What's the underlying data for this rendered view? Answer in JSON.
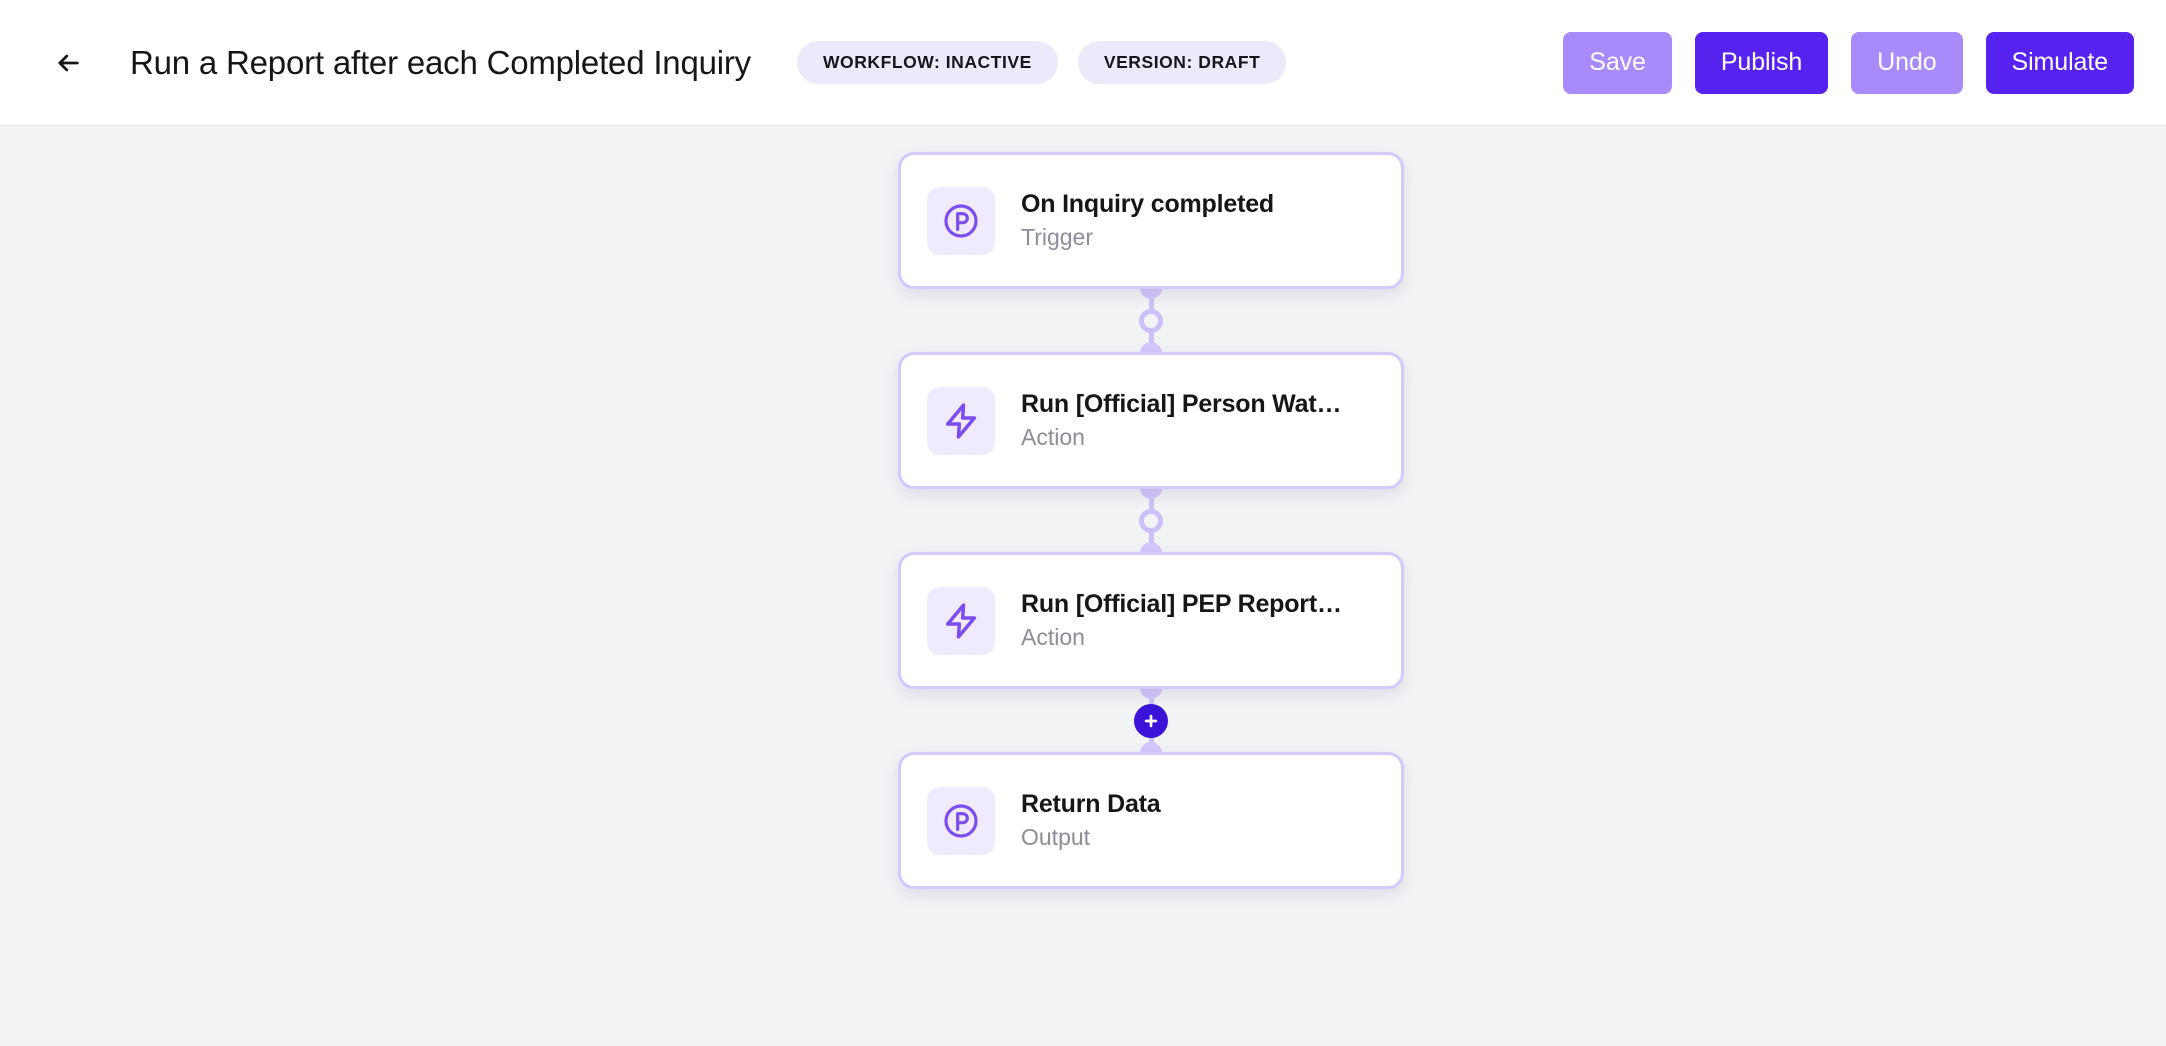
{
  "header": {
    "back_icon": "arrow-left-icon",
    "title": "Run a Report after each Completed Inquiry",
    "badges": [
      {
        "label": "WORKFLOW: INACTIVE"
      },
      {
        "label": "VERSION: DRAFT"
      }
    ],
    "buttons": [
      {
        "label": "Save",
        "style": "muted"
      },
      {
        "label": "Publish",
        "style": "strong"
      },
      {
        "label": "Undo",
        "style": "muted"
      },
      {
        "label": "Simulate",
        "style": "strong"
      }
    ]
  },
  "canvas": {
    "nodes": [
      {
        "icon": "circled-p-icon",
        "title": "On Inquiry completed",
        "subtitle": "Trigger"
      },
      {
        "icon": "zap-icon",
        "title": "Run [Official] Person Wat…",
        "subtitle": "Action"
      },
      {
        "icon": "zap-icon",
        "title": "Run [Official] PEP Report…",
        "subtitle": "Action"
      },
      {
        "icon": "circled-p-icon",
        "title": "Return Data",
        "subtitle": "Output"
      }
    ],
    "connectors": [
      {
        "type": "ring",
        "icon": "connector-ring-icon"
      },
      {
        "type": "ring",
        "icon": "connector-ring-icon"
      },
      {
        "type": "add",
        "icon": "plus-icon"
      }
    ]
  },
  "colors": {
    "accent_strong": "#5522f0",
    "accent_muted": "#a78bfa",
    "accent_deep": "#3a12d8",
    "icon_purple": "#7c4dee",
    "node_border": "#d5c9fb",
    "node_icon_bg": "#efeafd",
    "badge_bg": "#ece9fb",
    "canvas_bg": "#f2f3f5",
    "connector": "#cdc0fa",
    "text_primary": "#14161a",
    "text_muted": "#8b8d9b"
  }
}
